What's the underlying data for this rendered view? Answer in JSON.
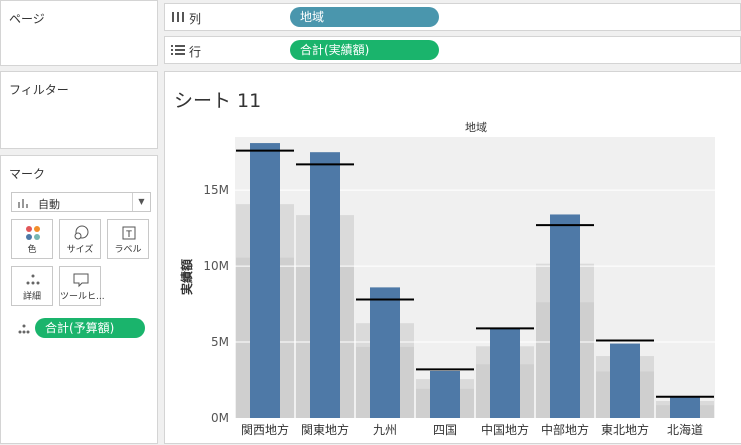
{
  "pages": {
    "title": "ページ"
  },
  "filters": {
    "title": "フィルター"
  },
  "marks": {
    "title": "マーク",
    "mark_type": "自動",
    "buttons": [
      {
        "label": "色",
        "icon": "color-dots-icon"
      },
      {
        "label": "サイズ",
        "icon": "size-icon"
      },
      {
        "label": "ラベル",
        "icon": "label-icon"
      },
      {
        "label": "詳細",
        "icon": "detail-icon"
      },
      {
        "label": "ツールヒ...",
        "icon": "tooltip-icon"
      }
    ],
    "detail_pill": "合計(予算額)"
  },
  "shelves": {
    "columns": {
      "label": "列",
      "pill": "地域"
    },
    "rows": {
      "label": "行",
      "pill": "合計(実績額)"
    }
  },
  "sheet": {
    "title": "シート 11"
  },
  "colors": {
    "bar": "#4e79a7",
    "budget_band": "#c8c8c8",
    "pane_bg": "#f0f0f0",
    "reference_line": "#000000",
    "pill_green": "#1ab46c",
    "pill_blue": "#4a96ad"
  },
  "chart_data": {
    "type": "bar",
    "header": "地域",
    "ylabel": "実績額",
    "categories": [
      "関西地方",
      "関東地方",
      "九州",
      "四国",
      "中国地方",
      "中部地方",
      "東北地方",
      "北海道"
    ],
    "series": [
      {
        "name": "合計(実績額)",
        "values": [
          18.1,
          17.5,
          8.6,
          3.1,
          5.9,
          13.4,
          4.9,
          1.4
        ]
      }
    ],
    "reference_values": [
      17.6,
      16.7,
      7.8,
      3.2,
      5.9,
      12.7,
      5.1,
      1.4
    ],
    "reference_label": "合計(予算額)",
    "ylim": [
      0,
      18.5
    ],
    "yticks": [
      0,
      5,
      10,
      15
    ],
    "ytick_labels": [
      "0M",
      "5M",
      "10M",
      "15M"
    ]
  }
}
